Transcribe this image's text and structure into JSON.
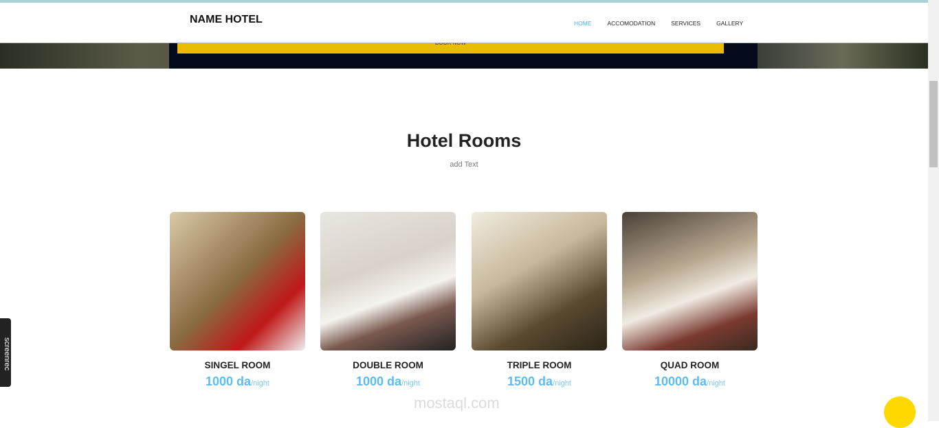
{
  "nav": {
    "logo": "NAME HOTEL",
    "items": [
      "HOME",
      "ACCOMODATION",
      "SERVICES",
      "GALLERY"
    ]
  },
  "hero": {
    "book_label": "BOOK NOW"
  },
  "section": {
    "title": "Hotel Rooms",
    "subtitle": "add Text"
  },
  "rooms": [
    {
      "name": "SINGEL ROOM",
      "price": "1000 da",
      "unit": "/night"
    },
    {
      "name": "DOUBLE ROOM",
      "price": "1000 da",
      "unit": "/night"
    },
    {
      "name": "TRIPLE ROOM",
      "price": "1500 da",
      "unit": "/night"
    },
    {
      "name": "QUAD ROOM",
      "price": "10000 da",
      "unit": "/night"
    }
  ],
  "overlay": {
    "recorder": "screenrec",
    "watermark": "mostaql.com"
  }
}
